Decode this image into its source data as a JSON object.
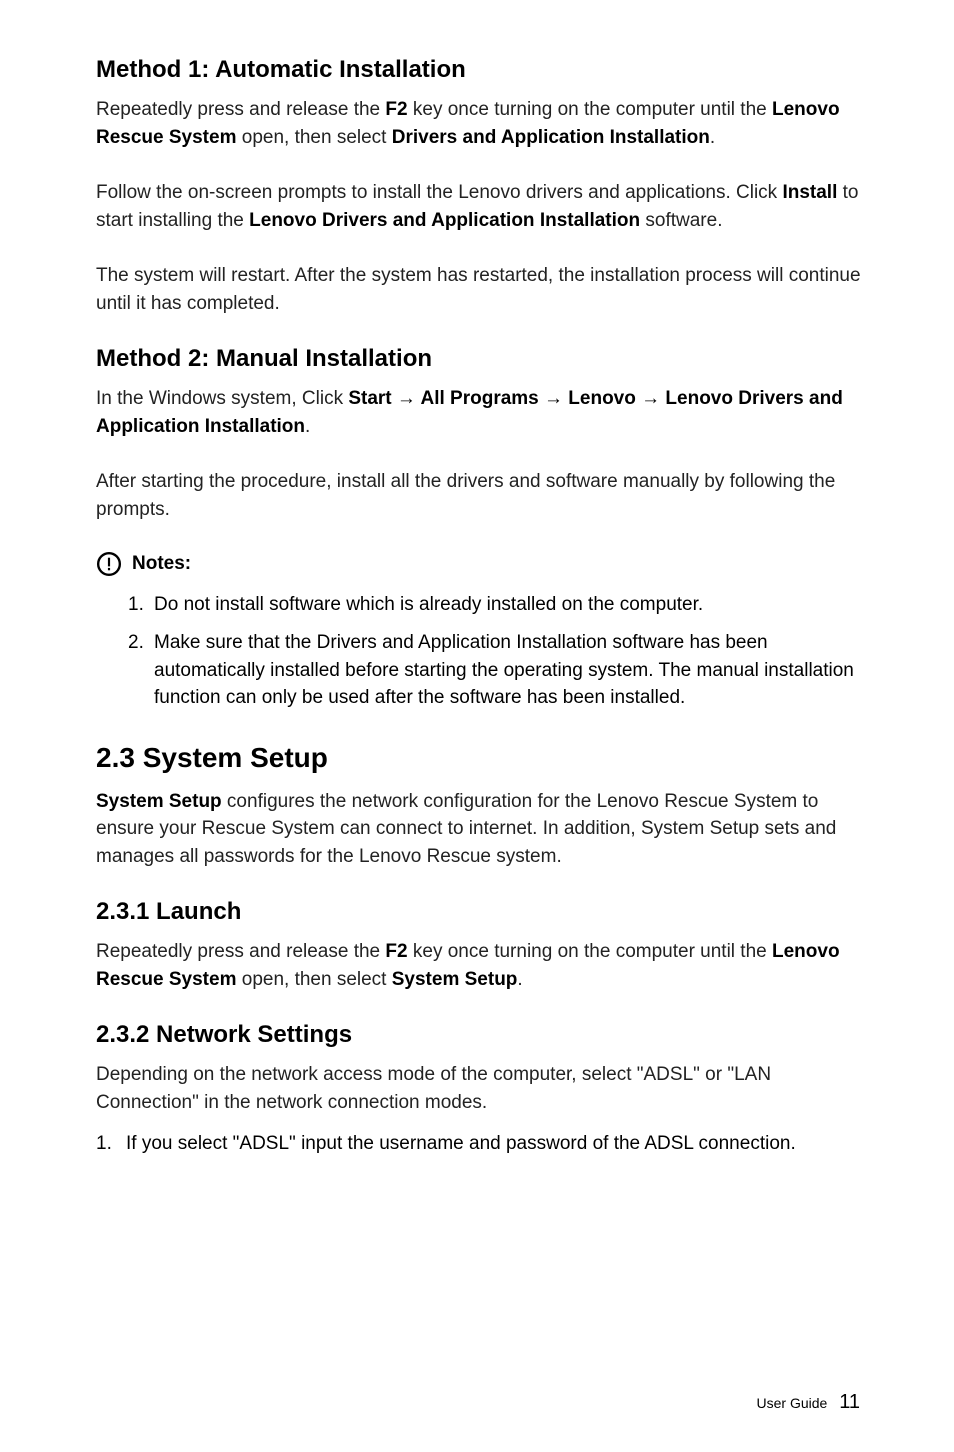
{
  "method1": {
    "heading": "Method 1: Automatic Installation",
    "p1_a": "Repeatedly press and release the ",
    "p1_b": "F2",
    "p1_c": " key once turning on the computer until the ",
    "p1_d": "Lenovo Rescue System",
    "p1_e": " open, then select ",
    "p1_f": "Drivers and Application Installation",
    "p1_g": ".",
    "p2_a": "Follow the on-screen prompts to install the Lenovo drivers and applications. Click ",
    "p2_b": "Install",
    "p2_c": " to start installing the ",
    "p2_d": "Lenovo Drivers and Application Installation",
    "p2_e": " software.",
    "p3": "The system will restart. After the system has restarted, the installation process will continue until it has completed."
  },
  "method2": {
    "heading": "Method 2: Manual Installation",
    "p1_a": "In the Windows system, Click ",
    "p1_b": "Start → All Programs → Lenovo → Lenovo Drivers and Application Installation",
    "p1_c": ".",
    "p2": "After starting the procedure, install all the drivers and software manually by following the prompts."
  },
  "notes": {
    "label": "Notes:",
    "items": [
      "Do not install software which is already installed on the computer.",
      "Make sure that the Drivers and Application Installation software has been automatically installed before starting the operating system. The manual installation function can only be used after the software has been installed."
    ]
  },
  "section23": {
    "heading": "2.3  System Setup",
    "p1_a": "System Setup",
    "p1_b": " configures the network configuration for the Lenovo Rescue System to ensure your Rescue System can connect to internet. In addition, System Setup sets and manages all passwords for the Lenovo Rescue system."
  },
  "section231": {
    "heading": "2.3.1 Launch",
    "p1_a": "Repeatedly press and release the ",
    "p1_b": "F2",
    "p1_c": " key once turning on the computer until the ",
    "p1_d": "Lenovo Rescue System",
    "p1_e": " open, then select ",
    "p1_f": "System Setup",
    "p1_g": "."
  },
  "section232": {
    "heading": "2.3.2 Network Settings",
    "p1": "Depending on the network access mode of the computer, select \"ADSL\" or \"LAN Connection\" in the network connection modes.",
    "li1": "If you select \"ADSL\" input the username and password of the ADSL connection."
  },
  "footer": {
    "label": "User Guide",
    "page": "11"
  }
}
